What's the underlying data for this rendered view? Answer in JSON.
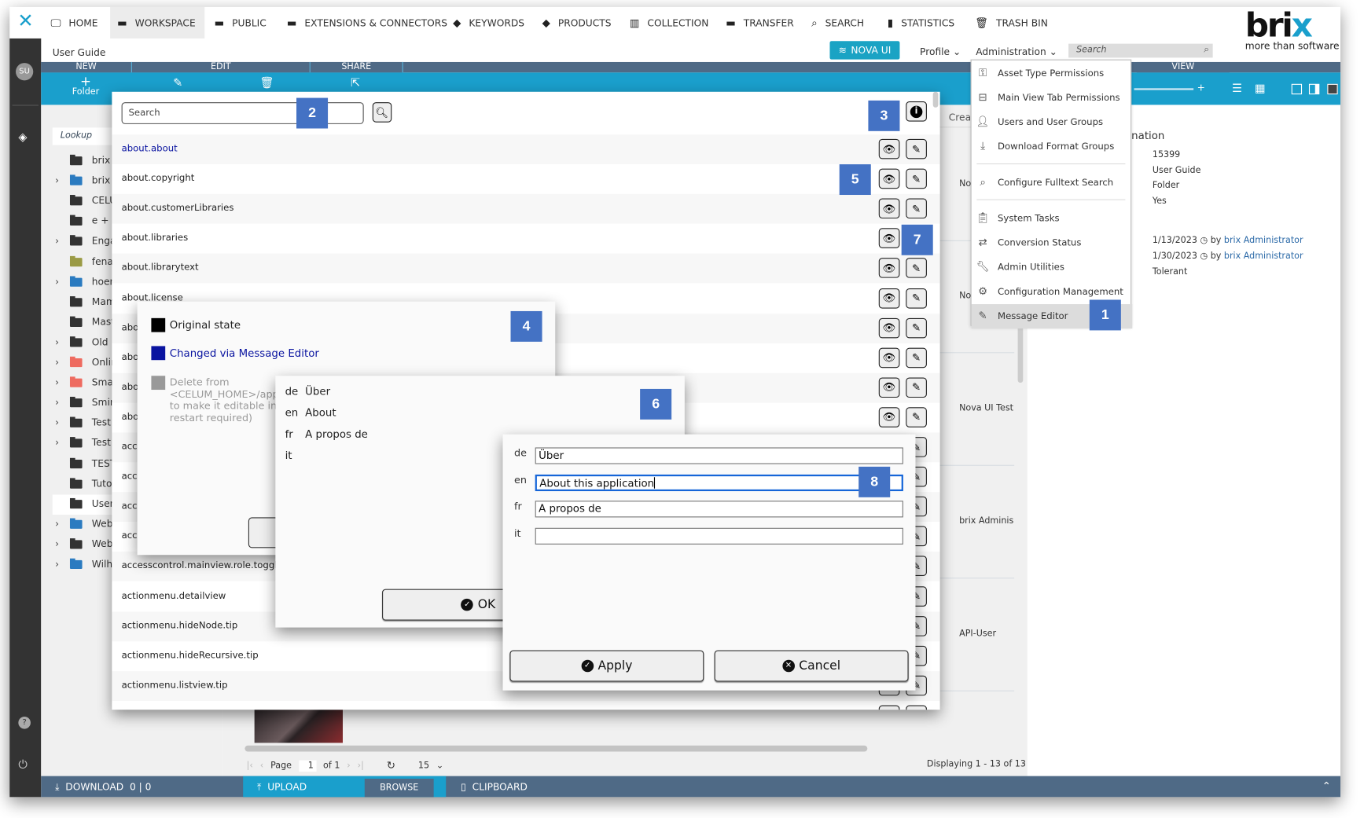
{
  "nav": {
    "items": [
      {
        "label": "HOME",
        "icon": "monitor-icon"
      },
      {
        "label": "WORKSPACE",
        "icon": "folder-icon",
        "selected": true
      },
      {
        "label": "PUBLIC",
        "icon": "folder-icon"
      },
      {
        "label": "EXTENSIONS & CONNECTORS",
        "icon": "folder-icon"
      },
      {
        "label": "KEYWORDS",
        "icon": "tag-icon"
      },
      {
        "label": "PRODUCTS",
        "icon": "tag-icon"
      },
      {
        "label": "COLLECTION",
        "icon": "collection-icon"
      },
      {
        "label": "TRANSFER",
        "icon": "folder-icon"
      },
      {
        "label": "SEARCH",
        "icon": "search-icon"
      },
      {
        "label": "STATISTICS",
        "icon": "bar-chart-icon"
      },
      {
        "label": "TRASH BIN",
        "icon": "trash-icon"
      }
    ]
  },
  "brand": {
    "logo": "brix",
    "tagline": "more than software",
    "color": "#1a9fcc"
  },
  "sidebar": {
    "avatar": "SU"
  },
  "header": {
    "breadcrumb": "User Guide",
    "nova_button": "NOVA UI",
    "profile": "Profile",
    "administration": "Administration",
    "search_placeholder": "Search"
  },
  "toolbar": {
    "sections": [
      "NEW",
      "EDIT",
      "SHARE",
      "VIEW"
    ],
    "folder_label": "Folder"
  },
  "tree": {
    "lookup_placeholder": "Lookup",
    "items": [
      {
        "label": "brix l",
        "color": "#333",
        "exp": false
      },
      {
        "label": "brix S",
        "color": "#2b7bc0",
        "exp": true
      },
      {
        "label": "CELU",
        "color": "#333",
        "exp": false
      },
      {
        "label": "e + h",
        "color": "#333",
        "exp": false
      },
      {
        "label": "Enga",
        "color": "#333",
        "exp": true
      },
      {
        "label": "fenac",
        "color": "#9a9a45",
        "exp": false
      },
      {
        "label": "hoer",
        "color": "#2b7bc0",
        "exp": true
      },
      {
        "label": "Mam",
        "color": "#333",
        "exp": false
      },
      {
        "label": "Mast",
        "color": "#333",
        "exp": false
      },
      {
        "label": "Old",
        "color": "#333",
        "exp": true
      },
      {
        "label": "Onlin",
        "color": "#ee6b60",
        "exp": true
      },
      {
        "label": "Smar",
        "color": "#ee6b60",
        "exp": true
      },
      {
        "label": "Smin",
        "color": "#333",
        "exp": true
      },
      {
        "label": "Test",
        "color": "#333",
        "exp": true
      },
      {
        "label": "Test",
        "color": "#333",
        "exp": true
      },
      {
        "label": "TEST",
        "color": "#333",
        "exp": false
      },
      {
        "label": "Tutor",
        "color": "#333",
        "exp": false
      },
      {
        "label": "User",
        "color": "#333",
        "exp": false,
        "selected": true
      },
      {
        "label": "Web",
        "color": "#2b7bc0",
        "exp": true
      },
      {
        "label": "Webi",
        "color": "#333",
        "exp": true
      },
      {
        "label": "Wilhe",
        "color": "#2b7bc0",
        "exp": true
      }
    ]
  },
  "content": {
    "column_header": "Creat",
    "cells": [
      "No",
      "No",
      "Nova UI Test .",
      "brix Administ",
      "API-User"
    ],
    "pagination": {
      "page_label": "Page",
      "page": "1",
      "of": "of 1",
      "per_page": "15",
      "displaying": "Displaying 1 - 13 of 13"
    }
  },
  "info": {
    "heading": "nation",
    "values": [
      "15399",
      "User Guide",
      "Folder",
      "Yes"
    ],
    "created": {
      "date": "1/13/2023",
      "by": "by",
      "user": "brix Administrator"
    },
    "modified": {
      "date": "1/30/2023",
      "by": "by",
      "user": "brix Administrator"
    },
    "last": "Tolerant"
  },
  "admin_menu": {
    "items": [
      {
        "label": "Asset Type Permissions",
        "icon": "asset-permission-icon"
      },
      {
        "label": "Main View Tab Permissions",
        "icon": "tab-permission-icon"
      },
      {
        "label": "Users and User Groups",
        "icon": "users-icon"
      },
      {
        "label": "Download Format Groups",
        "icon": "download-icon",
        "sep_after": true
      },
      {
        "label": "Configure Fulltext Search",
        "icon": "fulltext-search-icon",
        "sep_after": true
      },
      {
        "label": "System Tasks",
        "icon": "clipboard-check-icon"
      },
      {
        "label": "Conversion Status",
        "icon": "conversion-icon"
      },
      {
        "label": "Admin Utilities",
        "icon": "wrench-icon"
      },
      {
        "label": "Configuration Management",
        "icon": "gears-icon"
      },
      {
        "label": "Message Editor",
        "icon": "message-edit-icon",
        "highlighted": true
      }
    ]
  },
  "message_editor": {
    "search_placeholder": "Search",
    "rows": [
      {
        "key": "about.about",
        "changed": true
      },
      {
        "key": "about.copyright"
      },
      {
        "key": "about.customerLibraries"
      },
      {
        "key": "about.libraries"
      },
      {
        "key": "about.librarytext"
      },
      {
        "key": "about.license"
      },
      {
        "key": "abo"
      },
      {
        "key": "abo"
      },
      {
        "key": "abo"
      },
      {
        "key": "abo"
      },
      {
        "key": "acce"
      },
      {
        "key": "acce"
      },
      {
        "key": "acce"
      },
      {
        "key": "acce"
      },
      {
        "key": "accesscontrol.mainview.role.toggleIn"
      },
      {
        "key": "actionmenu.detailview"
      },
      {
        "key": "actionmenu.hideNode.tip"
      },
      {
        "key": "actionmenu.hideRecursive.tip"
      },
      {
        "key": "actionmenu.listview.tip"
      }
    ]
  },
  "legend_dialog": {
    "items": [
      {
        "label": "Original state",
        "color": "#000000"
      },
      {
        "label": "Changed via Message Editor",
        "color": "#0a14a0"
      }
    ],
    "delete_lines": [
      "Delete from",
      "<CELUM_HOME>/app",
      "to make it editable in",
      "restart required)"
    ],
    "delete_color": "#999999"
  },
  "view_dialog": {
    "rows": [
      {
        "lang": "de",
        "value": "Über"
      },
      {
        "lang": "en",
        "value": "About"
      },
      {
        "lang": "fr",
        "value": "A propos de"
      },
      {
        "lang": "it",
        "value": ""
      }
    ],
    "ok": "OK"
  },
  "edit_dialog": {
    "rows": [
      {
        "lang": "de",
        "value": "Über"
      },
      {
        "lang": "en",
        "value": "About this application"
      },
      {
        "lang": "fr",
        "value": "A propos de"
      },
      {
        "lang": "it",
        "value": ""
      }
    ],
    "apply": "Apply",
    "cancel": "Cancel"
  },
  "bottom": {
    "download": "DOWNLOAD",
    "download_count": "0 | 0",
    "upload": "UPLOAD",
    "browse": "BROWSE",
    "clipboard": "CLIPBOARD"
  },
  "badges": [
    "1",
    "2",
    "3",
    "4",
    "5",
    "6",
    "7",
    "8"
  ],
  "badge_color": "#4472c4"
}
